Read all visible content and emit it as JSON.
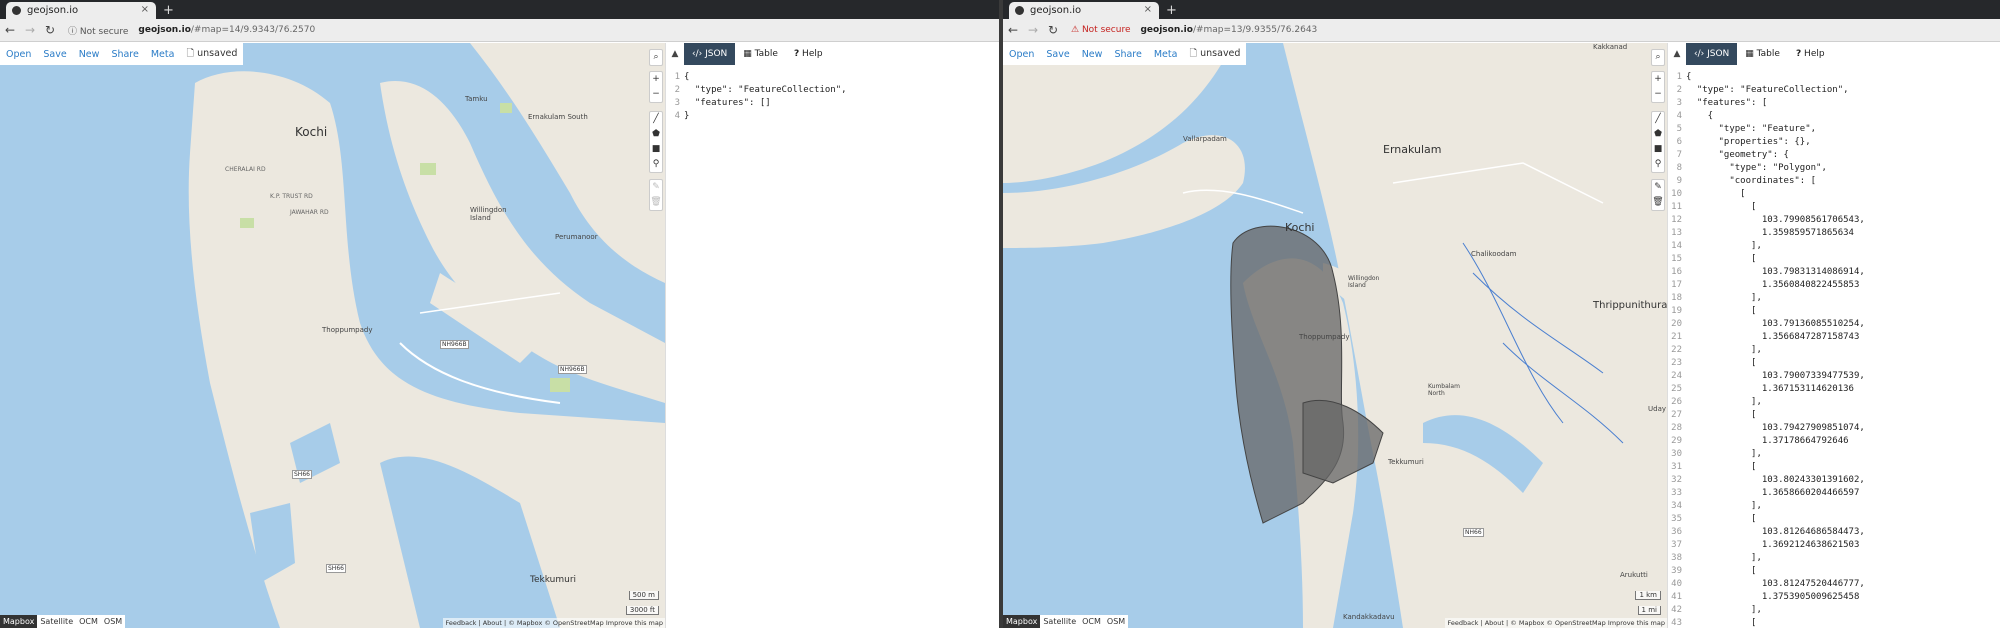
{
  "left": {
    "tab_title": "geojson.io",
    "security_label": "Not secure",
    "url_host": "geojson.io",
    "url_rest": "/#map=14/9.9343/76.2570",
    "toolbar": {
      "open": "Open",
      "save": "Save",
      "new": "New",
      "share": "Share",
      "meta": "Meta",
      "file_status": "unsaved"
    },
    "map_labels": {
      "kochi": "Kochi",
      "tamku": "Tamku",
      "ernakulam_south": "Ernakulam South",
      "willingdon": "Willingdon Island",
      "perumanoor": "Perumanoor",
      "thoppumpady": "Thoppumpady",
      "tekkumuri": "Tekkumuri",
      "cherai": "CHERALAI RD",
      "jawahar": "JAWAHAR RD",
      "kp": "K.P. TRUST RD",
      "road1": "NH966B",
      "road2": "NH966B",
      "road3": "SH66",
      "road4": "SH66"
    },
    "scale": {
      "metric": "500 m",
      "imperial": "3000 ft"
    },
    "layers": [
      "Mapbox",
      "Satellite",
      "OCM",
      "OSM"
    ],
    "attribution": "Feedback | About | © Mapbox © OpenStreetMap Improve this map",
    "panel_tabs": {
      "json": "JSON",
      "table": "Table",
      "help": "Help"
    },
    "code_lines": [
      "{",
      "  \"type\": \"FeatureCollection\",",
      "  \"features\": []",
      "}"
    ]
  },
  "right": {
    "tab_title": "geojson.io",
    "security_label": "Not secure",
    "url_host": "geojson.io",
    "url_rest": "/#map=13/9.9355/76.2643",
    "toolbar": {
      "open": "Open",
      "save": "Save",
      "new": "New",
      "share": "Share",
      "meta": "Meta",
      "file_status": "unsaved"
    },
    "map_labels": {
      "kakkanad": "Kakkanad",
      "vallarpadam": "Vallarpadam",
      "ernakulam": "Ernakulam",
      "kochi": "Kochi",
      "willingdon": "Willingdon Island",
      "chakkoodam": "Chalikoodam",
      "thrippunithura": "Thrippunithura",
      "thoppumpady": "Thoppumpady",
      "kumbalam": "Kumbalam North",
      "tekkumuri": "Tekkumuri",
      "arukutti": "Arukutti",
      "uday": "Uday",
      "kandakkadavu": "Kandakkadavu",
      "road": "NH66"
    },
    "scale": {
      "metric": "1 km",
      "imperial": "1 mi"
    },
    "layers": [
      "Mapbox",
      "Satellite",
      "OCM",
      "OSM"
    ],
    "attribution": "Feedback | About | © Mapbox © OpenStreetMap Improve this map",
    "panel_tabs": {
      "json": "JSON",
      "table": "Table",
      "help": "Help"
    },
    "code_lines": [
      "{",
      "  \"type\": \"FeatureCollection\",",
      "  \"features\": [",
      "    {",
      "      \"type\": \"Feature\",",
      "      \"properties\": {},",
      "      \"geometry\": {",
      "        \"type\": \"Polygon\",",
      "        \"coordinates\": [",
      "          [",
      "            [",
      "              103.79908561706543,",
      "              1.359859571865634",
      "            ],",
      "            [",
      "              103.79831314086914,",
      "              1.3560840822455853",
      "            ],",
      "            [",
      "              103.79136085510254,",
      "              1.3566847287158743",
      "            ],",
      "            [",
      "              103.79007339477539,",
      "              1.367153114620136",
      "            ],",
      "            [",
      "              103.79427909851074,",
      "              1.37178664792646",
      "            ],",
      "            [",
      "              103.80243301391602,",
      "              1.3658660204466597",
      "            ],",
      "            [",
      "              103.81264686584473,",
      "              1.3692124638621503",
      "            ],",
      "            [",
      "              103.81247520446777,",
      "              1.3753905009625458",
      "            ],",
      "            ["
    ]
  },
  "colors": {
    "water": "#a7cce9",
    "land": "#ece8df",
    "park": "#c8dfa6",
    "polygon": "#555555",
    "accent": "#34495e"
  }
}
